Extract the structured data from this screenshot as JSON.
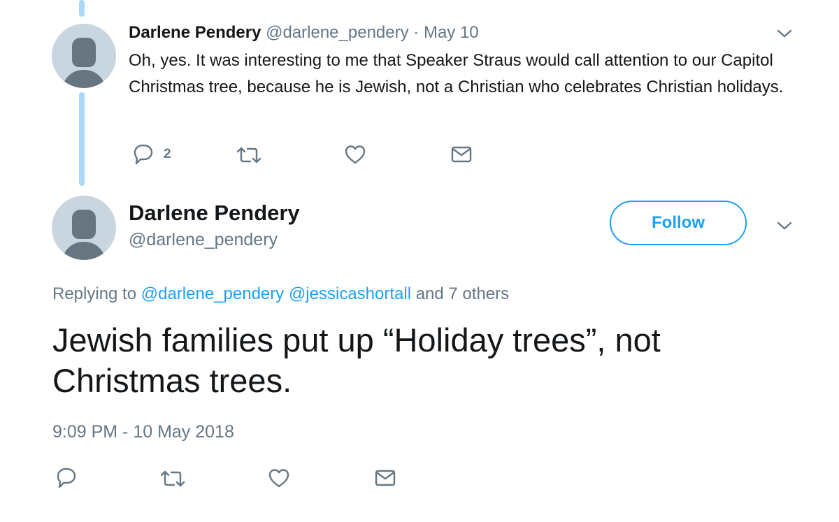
{
  "parent_tweet": {
    "display_name": "Darlene Pendery",
    "handle": "@darlene_pendery",
    "separator": "·",
    "date": "May 10",
    "text": "Oh, yes. It was interesting to me that Speaker Straus would call attention to our Capitol Christmas tree, because he is Jewish, not a Christian who celebrates Christian holidays.",
    "reply_count": "2",
    "icons": [
      "reply-icon",
      "retweet-icon",
      "like-icon",
      "direct-message-icon",
      "chevron-down-icon"
    ]
  },
  "main_tweet": {
    "display_name": "Darlene Pendery",
    "handle": "@darlene_pendery",
    "follow_label": "Follow",
    "replying_prefix": "Replying to",
    "reply_mention_1": "@darlene_pendery",
    "reply_mention_2": "@jessicashortall",
    "reply_suffix": "and 7 others",
    "text": "Jewish families put up “Holiday trees”, not Christmas trees.",
    "timestamp": "9:09 PM - 10 May 2018",
    "icons": [
      "reply-icon",
      "retweet-icon",
      "like-icon",
      "direct-message-icon",
      "chevron-down-icon"
    ]
  },
  "colors": {
    "accent": "#1da1f2",
    "muted_text": "#657786",
    "primary_text": "#14171a",
    "thread_line": "#aad8f6",
    "avatar_bg": "#c9d6df",
    "avatar_fg": "#66757f"
  }
}
